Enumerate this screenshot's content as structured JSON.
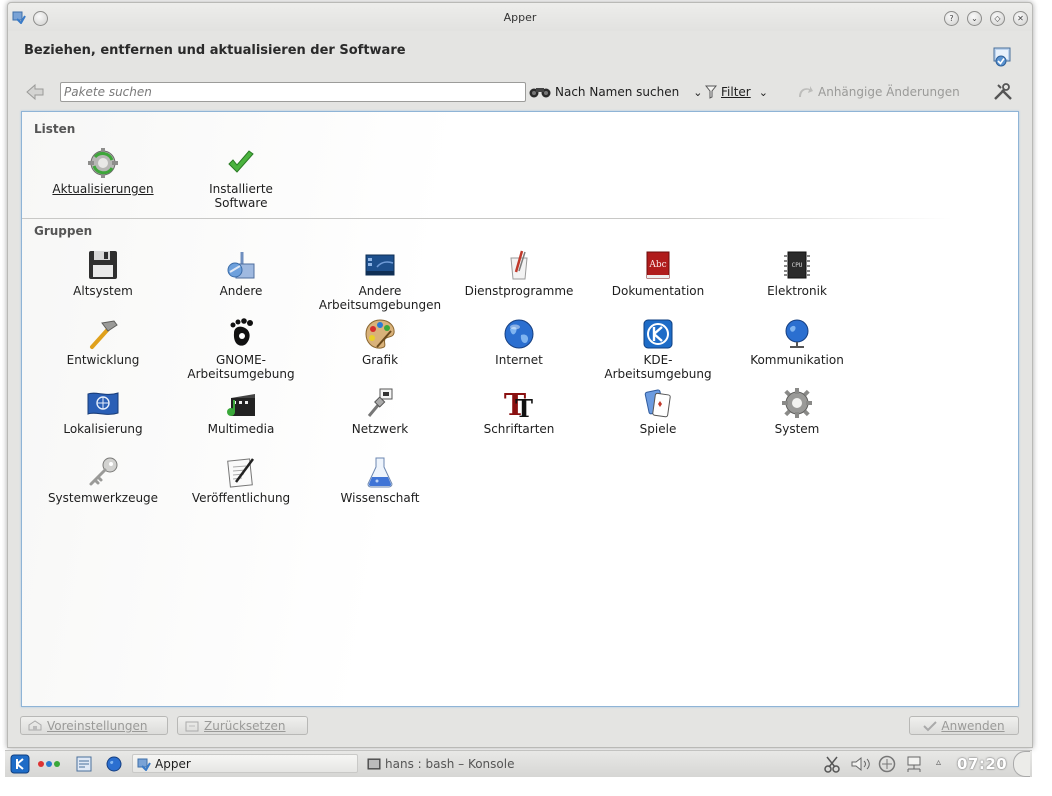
{
  "window": {
    "title": "Apper"
  },
  "header": {
    "title": "Beziehen, entfernen und aktualisieren der Software"
  },
  "toolbar": {
    "search_placeholder": "Pakete suchen",
    "search_mode": "Nach Namen suchen",
    "filter_label": "Filter",
    "pending_label": "Anhängige Änderungen"
  },
  "lists": {
    "title": "Listen",
    "items": [
      {
        "label": "Aktualisierungen",
        "icon": "updates-gear-icon"
      },
      {
        "label": "Installierte\nSoftware",
        "icon": "checkmark-icon"
      }
    ]
  },
  "groups": {
    "title": "Gruppen",
    "items": [
      {
        "label": "Altsystem",
        "icon": "floppy-disk-icon"
      },
      {
        "label": "Andere",
        "icon": "other-applications-icon"
      },
      {
        "label": "Andere\nArbeitsumgebungen",
        "icon": "desktop-environment-icon"
      },
      {
        "label": "Dienstprogramme",
        "icon": "utilities-icon"
      },
      {
        "label": "Dokumentation",
        "icon": "documentation-book-icon"
      },
      {
        "label": "Elektronik",
        "icon": "chip-icon"
      },
      {
        "label": "Entwicklung",
        "icon": "hammer-icon"
      },
      {
        "label": "GNOME-\nArbeitsumgebung",
        "icon": "gnome-foot-icon"
      },
      {
        "label": "Grafik",
        "icon": "palette-icon"
      },
      {
        "label": "Internet",
        "icon": "globe-icon"
      },
      {
        "label": "KDE-\nArbeitsumgebung",
        "icon": "kde-logo-icon"
      },
      {
        "label": "Kommunikation",
        "icon": "network-globe-icon"
      },
      {
        "label": "Lokalisierung",
        "icon": "un-flag-icon"
      },
      {
        "label": "Multimedia",
        "icon": "multimedia-icon"
      },
      {
        "label": "Netzwerk",
        "icon": "network-cable-icon"
      },
      {
        "label": "Schriftarten",
        "icon": "font-icon"
      },
      {
        "label": "Spiele",
        "icon": "playing-cards-icon"
      },
      {
        "label": "System",
        "icon": "system-gear-icon"
      },
      {
        "label": "Systemwerkzeuge",
        "icon": "key-icon"
      },
      {
        "label": "Veröffentlichung",
        "icon": "publishing-pen-icon"
      },
      {
        "label": "Wissenschaft",
        "icon": "flask-icon"
      }
    ]
  },
  "buttons": {
    "defaults": "Voreinstellungen",
    "reset": "Zurücksetzen",
    "apply": "Anwenden"
  },
  "taskbar": {
    "tasks": [
      {
        "label": "Apper"
      },
      {
        "label": "hans : bash – Konsole"
      }
    ],
    "clock": "07:20"
  }
}
